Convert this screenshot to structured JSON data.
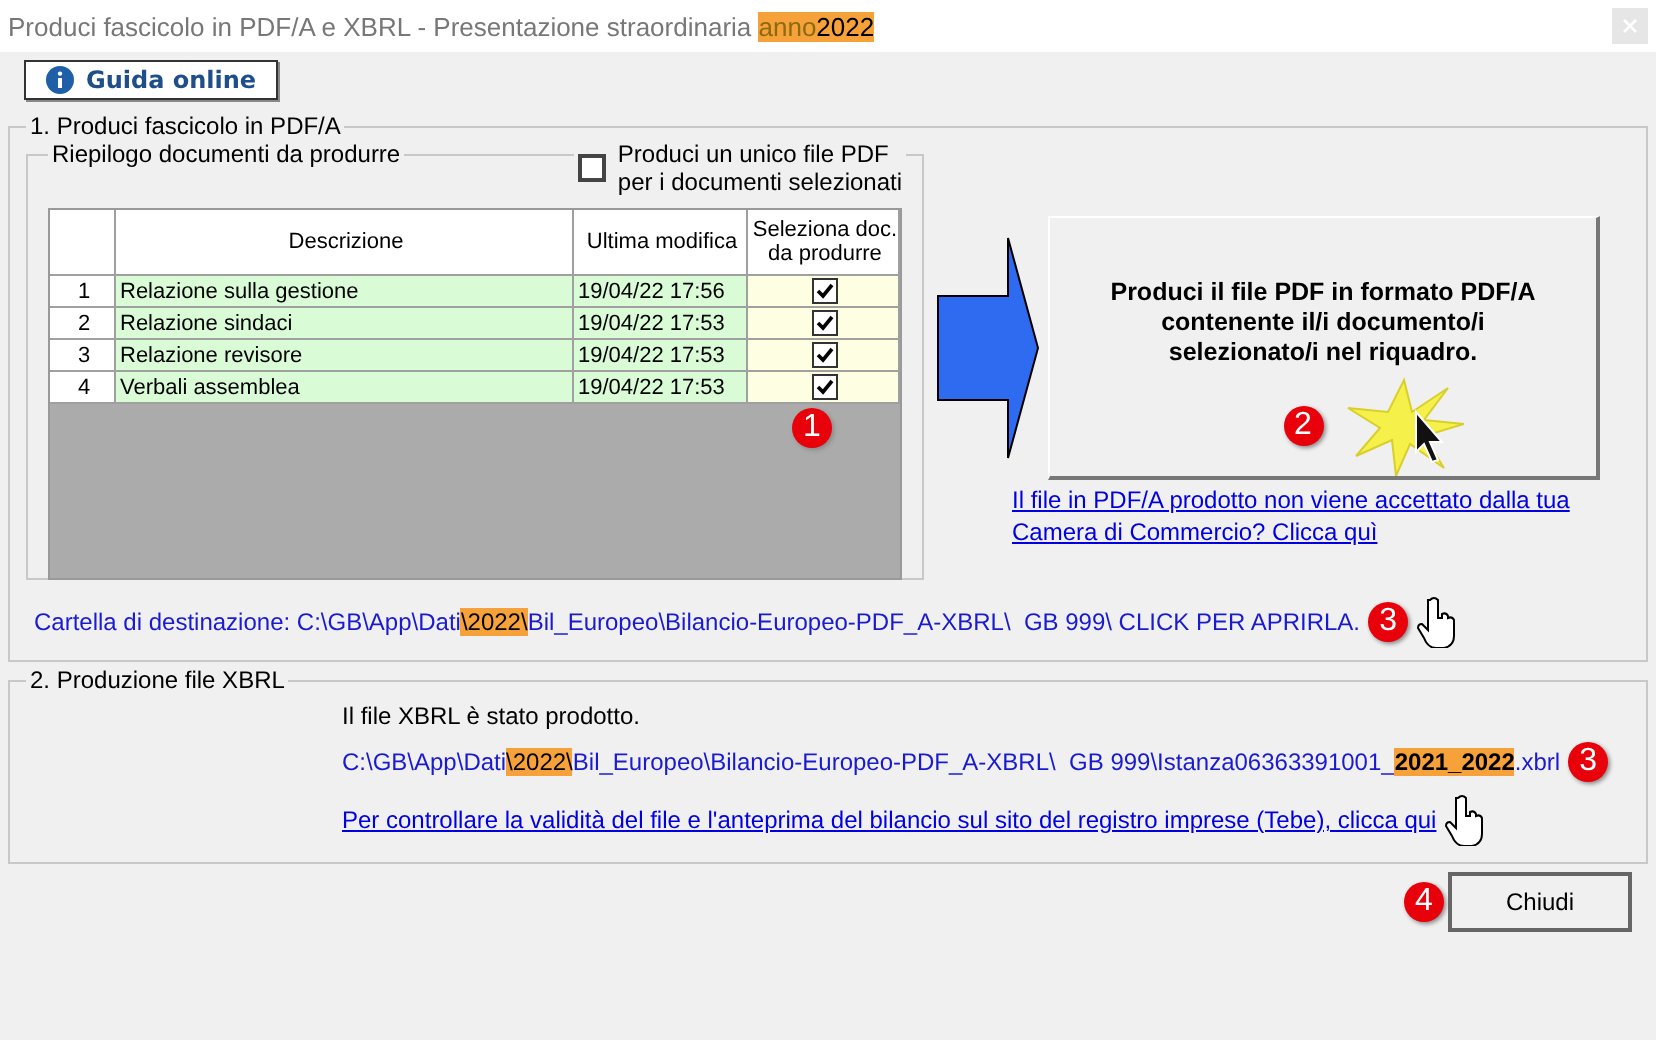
{
  "window": {
    "title_parts": [
      {
        "text": "Produci fascicolo in PDF/A e XBRL - Presentazione straordinaria ",
        "highlight": false,
        "muted": false
      },
      {
        "text": "anno",
        "highlight": true,
        "muted": true
      },
      {
        "text": "2022",
        "highlight": true,
        "muted": false
      }
    ]
  },
  "help_button": {
    "label": "Guida online"
  },
  "section1": {
    "title": "1. Produci fascicolo in PDF/A",
    "summary": {
      "title": "Riepilogo documenti da produrre",
      "single_pdf": {
        "label_lines": [
          "Produci un unico file PDF",
          "per i documenti selezionati"
        ],
        "checked": false
      },
      "table": {
        "columns": [
          "Descrizione",
          "Ultima modifica",
          [
            "Seleziona doc.",
            "da produrre"
          ]
        ],
        "rows": [
          {
            "number": "1",
            "description": "Relazione sulla gestione",
            "modified": "19/04/22 17:56",
            "checked": true
          },
          {
            "number": "2",
            "description": "Relazione sindaci",
            "modified": "19/04/22 17:53",
            "checked": true
          },
          {
            "number": "3",
            "description": "Relazione revisore",
            "modified": "19/04/22 17:53",
            "checked": true
          },
          {
            "number": "4",
            "description": "Verbali assemblea",
            "modified": "19/04/22 17:53",
            "checked": true
          }
        ],
        "badge": "1"
      }
    },
    "produce_button": {
      "lines": [
        "Produci il file PDF in formato PDF/A",
        "contenente il/i documento/i",
        "selezionato/i nel riquadro."
      ],
      "badge": "2"
    },
    "rejected_link": {
      "lines": [
        "Il file in PDF/A prodotto non viene accettato dalla tua",
        "Camera di Commercio? Clicca quì"
      ]
    },
    "destination": {
      "parts": [
        {
          "text": "Cartella di destinazione: C:\\GB\\App\\Dati",
          "highlight": false
        },
        {
          "text": "\\2022\\",
          "highlight": true
        },
        {
          "text": "Bil_Europeo\\Bilancio-Europeo-PDF_A-XBRL\\  GB 999\\ CLICK PER APRIRLA.",
          "highlight": false
        }
      ],
      "badge": "3"
    }
  },
  "section2": {
    "title": "2. Produzione file XBRL",
    "status": "Il file XBRL  è stato prodotto.",
    "path_parts": [
      {
        "text": "C:\\GB\\App\\Dati",
        "highlight": false
      },
      {
        "text": "\\2022\\",
        "highlight": true
      },
      {
        "text": "Bil_Europeo\\Bilancio-Europeo-PDF_A-XBRL\\  GB 999\\Istanza06363391001_",
        "highlight": false
      },
      {
        "text": "2021_2022",
        "highlight": true
      },
      {
        "text": ".xbrl",
        "highlight": false
      }
    ],
    "check_link": "Per controllare la validità del file e l'anteprima del bilancio sul sito del registro imprese (Tebe), clicca qui",
    "badge": "3"
  },
  "close_button": {
    "label": "Chiudi",
    "badge": "4"
  }
}
